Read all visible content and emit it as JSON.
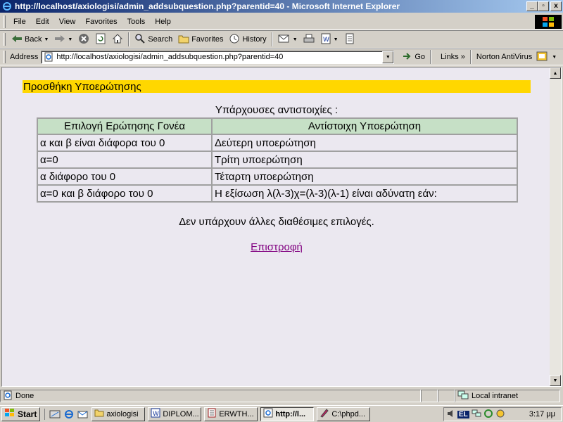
{
  "window": {
    "title": "http://localhost/axiologisi/admin_addsubquestion.php?parentid=40 - Microsoft Internet Explorer",
    "controls": {
      "minimize": "_",
      "maximize": "▫",
      "close": "x"
    }
  },
  "menu": {
    "items": [
      "File",
      "Edit",
      "View",
      "Favorites",
      "Tools",
      "Help"
    ]
  },
  "toolbar": {
    "back": "Back",
    "search": "Search",
    "favorites": "Favorites",
    "history": "History"
  },
  "address": {
    "label": "Address",
    "url": "http://localhost/axiologisi/admin_addsubquestion.php?parentid=40",
    "go": "Go",
    "links": "Links",
    "links_chevron": "»",
    "norton": "Norton AntiVirus"
  },
  "page": {
    "heading": "Προσθήκη Υποερώτησης",
    "caption": "Υπάρχουσες αντιστοιχίες :",
    "table": {
      "headers": [
        "Επιλογή Ερώτησης Γονέα",
        "Αντίστοιχη Υποερώτηση"
      ],
      "rows": [
        [
          "α και β είναι διάφορα του 0",
          "Δεύτερη υποερώτηση"
        ],
        [
          "α=0",
          "Τρίτη υποερώτηση"
        ],
        [
          "α διάφορο του 0",
          "Τέταρτη υποερώτηση"
        ],
        [
          "α=0 και β διάφορο του 0",
          "Η εξίσωση λ(λ-3)χ=(λ-3)(λ-1) είναι αδύνατη εάν:"
        ]
      ]
    },
    "no_more_options": "Δεν υπάρχουν άλλες διαθέσιμες επιλογές.",
    "back_link": "Επιστροφή"
  },
  "status": {
    "text": "Done",
    "zone": "Local intranet"
  },
  "taskbar": {
    "start": "Start",
    "tasks": [
      {
        "label": "axiologisi",
        "active": false
      },
      {
        "label": "DIPLOM...",
        "active": false
      },
      {
        "label": "ERWTH...",
        "active": false
      },
      {
        "label": "http://l...",
        "active": true
      },
      {
        "label": "C:\\phpd...",
        "active": false
      }
    ],
    "language": "EL",
    "clock": "3:17 μμ"
  },
  "colors": {
    "title_gradient_start": "#0a246a",
    "heading_bar": "#ffd700",
    "table_header": "#c6e0c6",
    "content_bg": "#ebe8f0",
    "visited_link": "#800080"
  }
}
